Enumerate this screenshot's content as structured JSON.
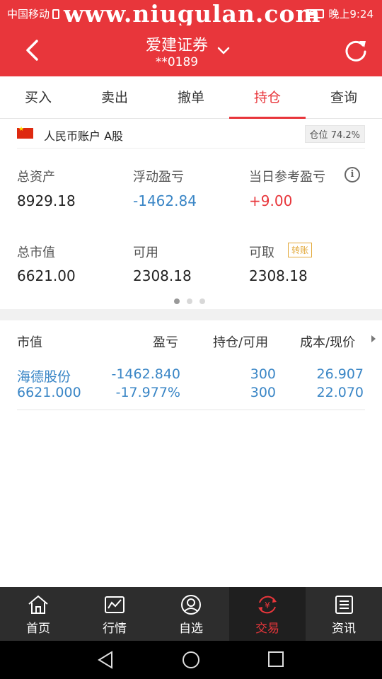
{
  "status_bar": {
    "carrier": "中国移动",
    "watermark": "www.niugulan.com",
    "time": "晚上9:24"
  },
  "header": {
    "title": "爱建证券",
    "account_mask": "**0189",
    "icons": [
      "back-arrow-icon",
      "chevron-down-icon",
      "refresh-icon"
    ]
  },
  "tabs": [
    {
      "label": "买入",
      "active": false
    },
    {
      "label": "卖出",
      "active": false
    },
    {
      "label": "撤单",
      "active": false
    },
    {
      "label": "持仓",
      "active": true
    },
    {
      "label": "查询",
      "active": false
    }
  ],
  "account": {
    "name": "人民币账户 A股",
    "position_label": "仓位",
    "position_value": "74.2%"
  },
  "summary": {
    "total_assets_label": "总资产",
    "total_assets": "8929.18",
    "floating_pl_label": "浮动盈亏",
    "floating_pl": "-1462.84",
    "day_pl_label": "当日参考盈亏",
    "day_pl": "+9.00",
    "market_value_label": "总市值",
    "market_value": "6621.00",
    "available_label": "可用",
    "available": "2308.18",
    "withdrawable_label": "可取",
    "withdrawable": "2308.18",
    "transfer_label": "转账"
  },
  "holdings": {
    "headers": [
      "市值",
      "盈亏",
      "持仓/可用",
      "成本/现价"
    ],
    "rows": [
      {
        "name": "海德股份",
        "market_value": "6621.000",
        "pl": "-1462.840",
        "pl_pct": "-17.977%",
        "position": "300",
        "available": "300",
        "cost": "26.907",
        "price": "22.070"
      }
    ]
  },
  "bottom_nav": [
    {
      "label": "首页",
      "icon": "home-icon",
      "active": false
    },
    {
      "label": "行情",
      "icon": "market-chart-icon",
      "active": false
    },
    {
      "label": "自选",
      "icon": "user-circle-icon",
      "active": false
    },
    {
      "label": "交易",
      "icon": "yuan-exchange-icon",
      "active": true
    },
    {
      "label": "资讯",
      "icon": "news-icon",
      "active": false
    }
  ],
  "colors": {
    "brand_red": "#e8363b",
    "loss_blue": "#3a86c6",
    "transfer_orange": "#e3a93b"
  }
}
